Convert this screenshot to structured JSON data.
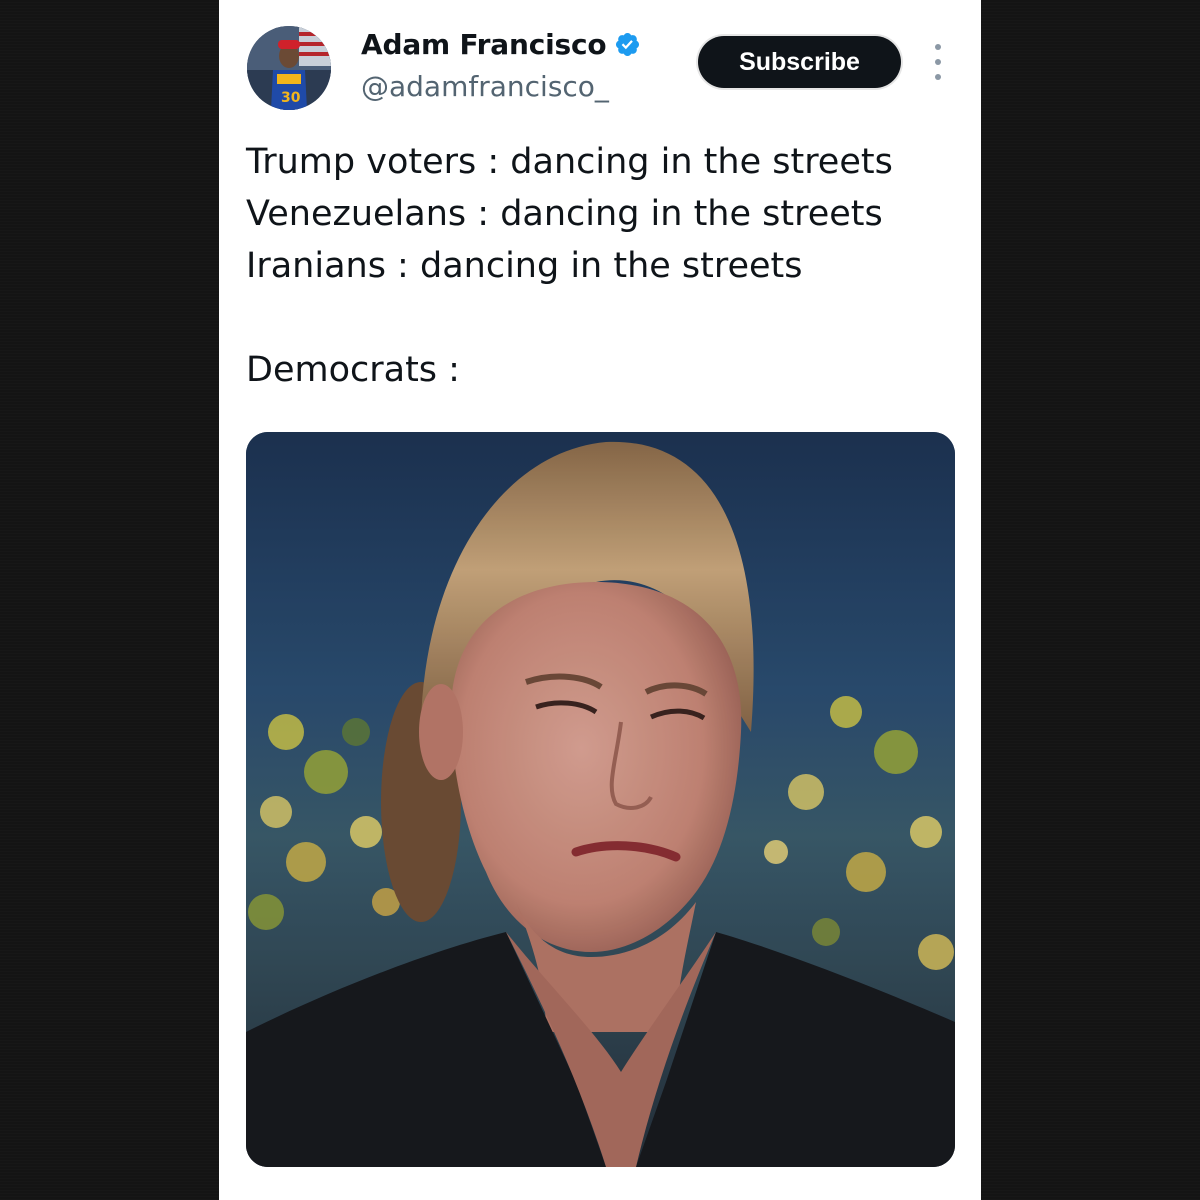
{
  "post": {
    "author": {
      "display_name": "Adam Francisco",
      "handle": "@adamfrancisco_",
      "verified": true,
      "avatar_icon": "avatar-image"
    },
    "subscribe_label": "Subscribe",
    "more_icon": "more-options-icon",
    "text_lines": [
      "Trump voters : dancing in the streets",
      "Venezuelans : dancing in the streets",
      "Iranians : dancing in the streets",
      "Democrats :"
    ],
    "media": {
      "type": "image"
    }
  },
  "colors": {
    "page_background": "#141414",
    "card_background": "#ffffff",
    "text_primary": "#0f1419",
    "text_secondary": "#536471",
    "button_background": "#0f1419",
    "verified_blue": "#1d9bf0"
  }
}
